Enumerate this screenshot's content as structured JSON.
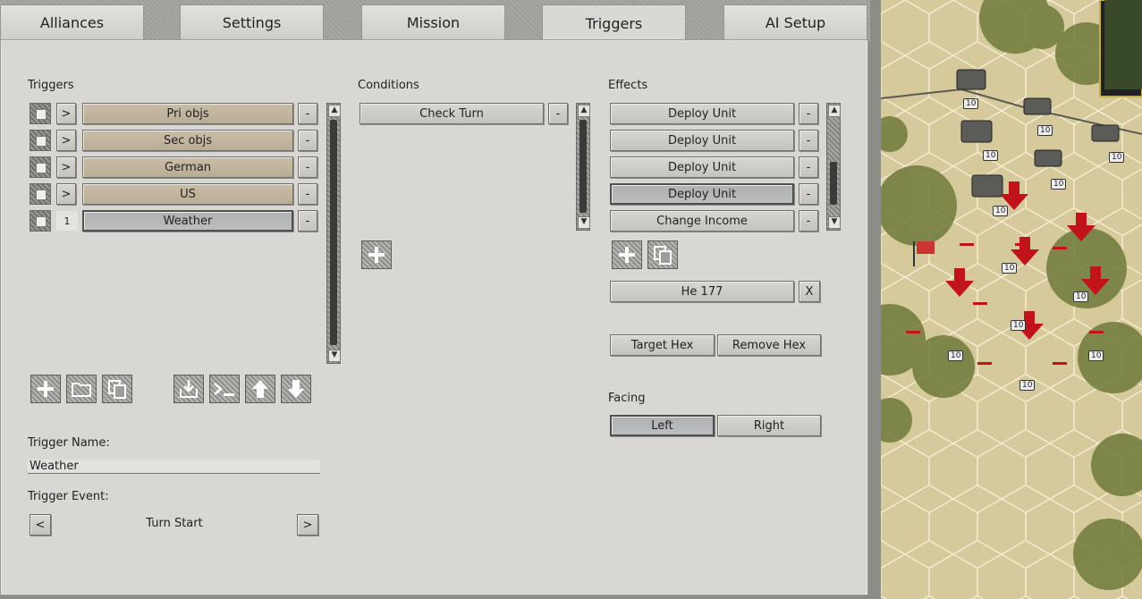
{
  "tabs": [
    "Alliances",
    "Settings",
    "Mission",
    "Triggers",
    "AI Setup"
  ],
  "active_tab": "Triggers",
  "triggers": {
    "title": "Triggers",
    "rows": [
      {
        "order": ">",
        "name": "Pri objs",
        "remove": "-"
      },
      {
        "order": ">",
        "name": "Sec objs",
        "remove": "-"
      },
      {
        "order": ">",
        "name": "German",
        "remove": "-"
      },
      {
        "order": ">",
        "name": "US",
        "remove": "-"
      },
      {
        "order": "1",
        "name": "Weather",
        "remove": "-"
      }
    ]
  },
  "conditions": {
    "title": "Conditions",
    "rows": [
      {
        "name": "Check Turn",
        "remove": "-"
      }
    ]
  },
  "effects": {
    "title": "Effects",
    "rows": [
      {
        "name": "Deploy Unit",
        "remove": "-"
      },
      {
        "name": "Deploy Unit",
        "remove": "-"
      },
      {
        "name": "Deploy Unit",
        "remove": "-"
      },
      {
        "name": "Deploy Unit",
        "remove": "-"
      },
      {
        "name": "Change Income",
        "remove": "-"
      }
    ],
    "unit_name": "He 177",
    "unit_clear": "X",
    "target_hex": "Target Hex",
    "remove_hex": "Remove Hex",
    "facing_label": "Facing",
    "facing_left": "Left",
    "facing_right": "Right"
  },
  "trigger_name_label": "Trigger Name:",
  "trigger_name_value": "Weather",
  "trigger_event_label": "Trigger Event:",
  "trigger_event_value": "Turn Start",
  "trigger_event_prev": "<",
  "trigger_event_next": ">",
  "toolbar_icons": [
    "add-icon",
    "folder-icon",
    "copy-icon",
    "import-icon",
    "console-icon",
    "move-up-icon",
    "move-down-icon"
  ],
  "map_badge_value": "10",
  "colors": {
    "panel": "#d8d7d3",
    "tan_button": "#c2b69f",
    "selected_button": "#b4b5b7",
    "marker_red": "#c0141a"
  }
}
